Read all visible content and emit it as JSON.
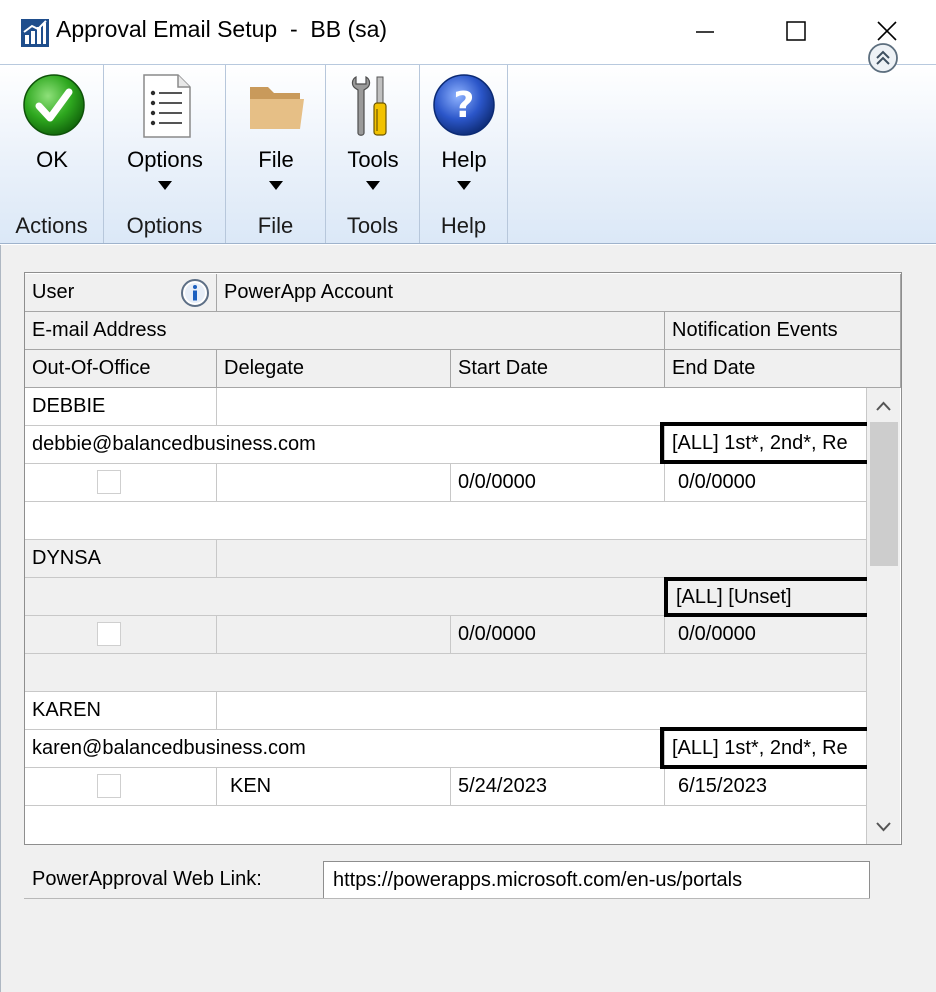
{
  "window": {
    "title": "Approval Email Setup  -  BB (sa)",
    "app_icon": "chart-icon",
    "controls": [
      "minimize-icon",
      "maximize-icon",
      "close-icon"
    ]
  },
  "ribbon": {
    "groups": [
      {
        "label": "OK",
        "group": "Actions",
        "icon": "checkmark-icon",
        "has_dropdown": false
      },
      {
        "label": "Options",
        "group": "Options",
        "icon": "list-document-icon",
        "has_dropdown": true
      },
      {
        "label": "File",
        "group": "File",
        "icon": "folder-icon",
        "has_dropdown": true
      },
      {
        "label": "Tools",
        "group": "Tools",
        "icon": "tools-icon",
        "has_dropdown": true
      },
      {
        "label": "Help",
        "group": "Help",
        "icon": "help-icon",
        "has_dropdown": true
      }
    ]
  },
  "grid": {
    "headers": {
      "user": "User",
      "powerapp_account": "PowerApp Account",
      "email_address": "E-mail Address",
      "notification_events": "Notification Events",
      "out_of_office": "Out-Of-Office",
      "delegate": "Delegate",
      "start_date": "Start Date",
      "end_date": "End Date"
    },
    "records": [
      {
        "user": "DEBBIE",
        "powerapp_account": "",
        "email": "debbie@balancedbusiness.com",
        "notification_events": "[ALL] 1st*, 2nd*, Re",
        "out_of_office": false,
        "delegate": "",
        "start_date": "0/0/0000",
        "end_date": "0/0/0000"
      },
      {
        "user": "DYNSA",
        "powerapp_account": "",
        "email": "",
        "notification_events": "[ALL] [Unset]",
        "out_of_office": false,
        "delegate": "",
        "start_date": "0/0/0000",
        "end_date": "0/0/0000"
      },
      {
        "user": "KAREN",
        "powerapp_account": "",
        "email": "karen@balancedbusiness.com",
        "notification_events": "[ALL] 1st*, 2nd*, Re",
        "out_of_office": false,
        "delegate": "KEN",
        "start_date": "5/24/2023",
        "end_date": "6/15/2023"
      }
    ]
  },
  "weblink": {
    "label": "PowerApproval Web Link:",
    "value": "https://powerapps.microsoft.com/en-us/portals"
  }
}
